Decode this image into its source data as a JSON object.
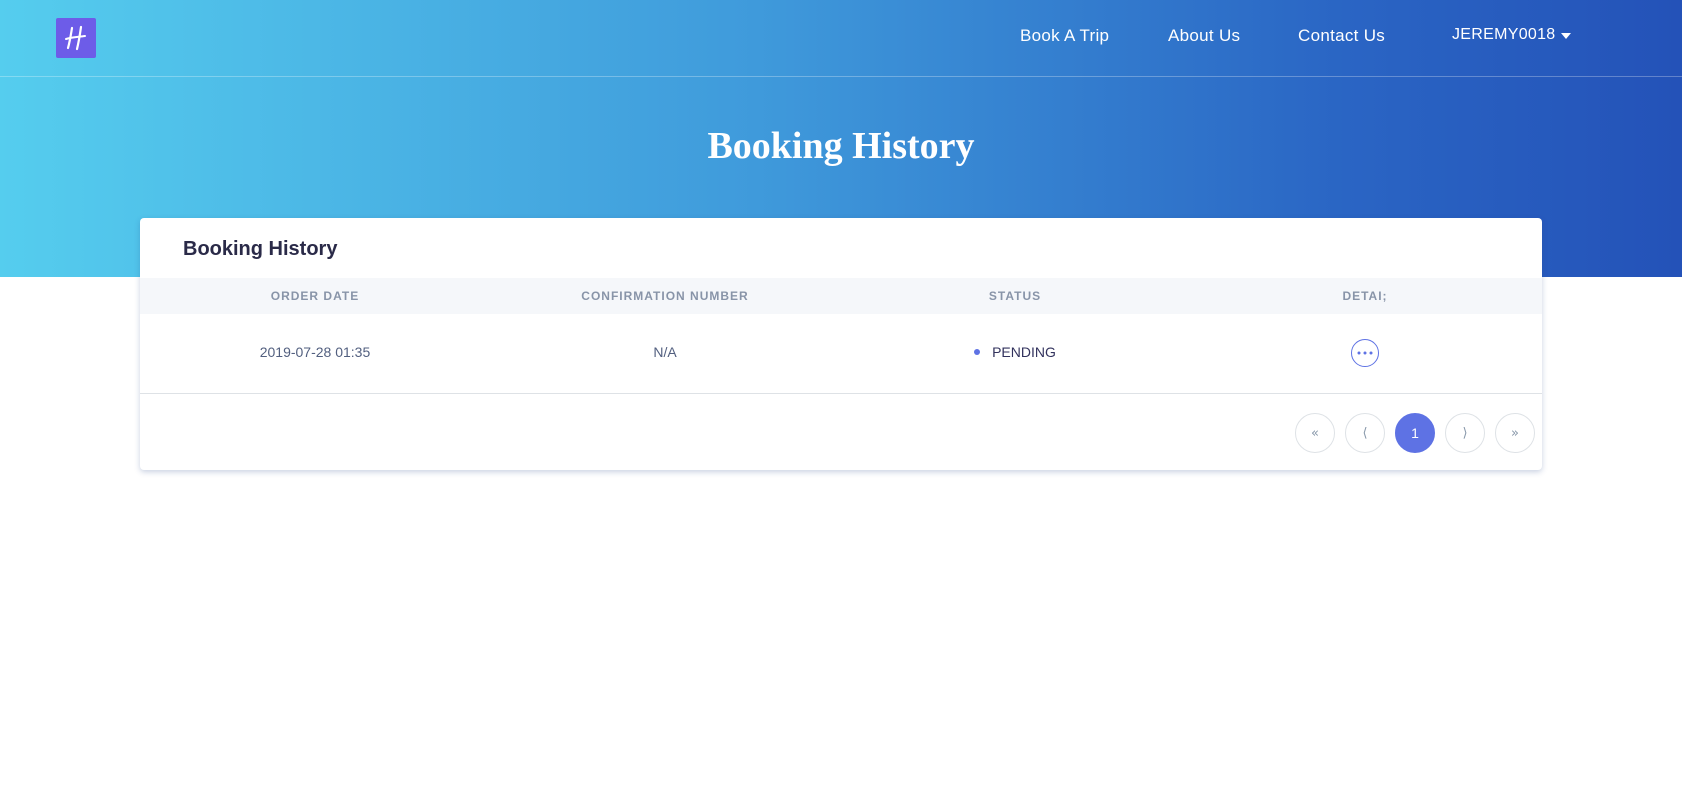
{
  "nav": {
    "links": [
      "Book A Trip",
      "About Us",
      "Contact Us"
    ],
    "user": "JEREMY0018"
  },
  "logo": {
    "glyph": "H"
  },
  "hero": {
    "title": "Booking History"
  },
  "card": {
    "title": "Booking History",
    "columns": [
      "ORDER DATE",
      "CONFIRMATION NUMBER",
      "STATUS",
      "DETAI;"
    ],
    "rows": [
      {
        "order_date": "2019-07-28 01:35",
        "confirmation_number": "N/A",
        "status": "PENDING"
      }
    ]
  },
  "pagination": {
    "first": "«",
    "prev": "⟨",
    "current": "1",
    "next": "⟩",
    "last": "»"
  },
  "colors": {
    "accent": "#5e72e4",
    "logo_bg": "#6d5ce8",
    "gradient_start": "#55cdee",
    "gradient_end": "#2452b8"
  },
  "icons": {
    "logo": "h-script-logo-icon",
    "user_menu": "caret-down-icon",
    "detail": "more-horizontal-icon",
    "status": "dot-icon"
  }
}
